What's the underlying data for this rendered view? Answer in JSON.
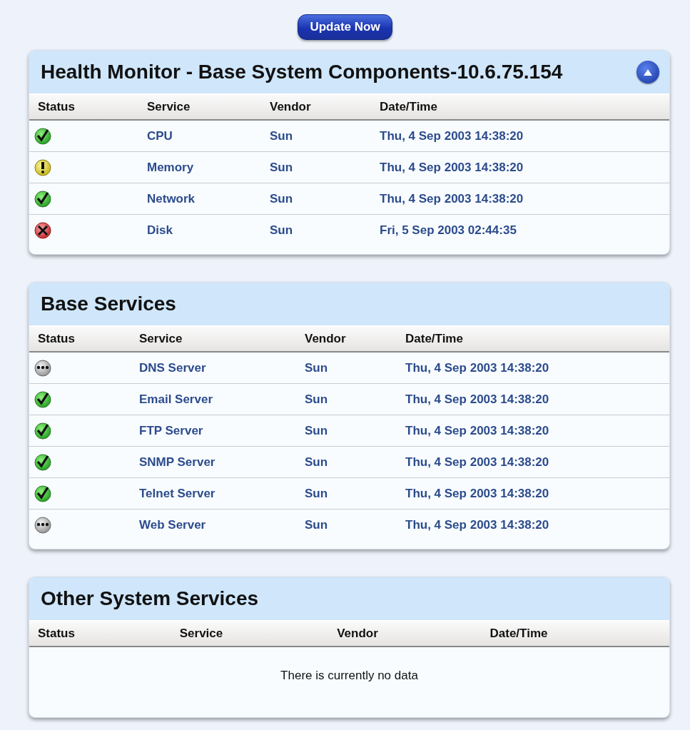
{
  "update_button": "Update Now",
  "panels": [
    {
      "title": "Health Monitor - Base System Components-10.6.75.154",
      "collapse_button": true,
      "columns": [
        "Status",
        "Service",
        "Vendor",
        "Date/Time"
      ],
      "rows": [
        {
          "kind": "ok",
          "service": "CPU",
          "vendor": "Sun",
          "datetime": "Thu, 4 Sep 2003 14:38:20"
        },
        {
          "kind": "warning",
          "service": "Memory",
          "vendor": "Sun",
          "datetime": "Thu, 4 Sep 2003 14:38:20"
        },
        {
          "kind": "ok",
          "service": "Network",
          "vendor": "Sun",
          "datetime": "Thu, 4 Sep 2003 14:38:20"
        },
        {
          "kind": "error",
          "service": "Disk",
          "vendor": "Sun",
          "datetime": "Fri, 5 Sep 2003 02:44:35"
        }
      ]
    },
    {
      "title": "Base Services",
      "collapse_button": false,
      "columns": [
        "Status",
        "Service",
        "Vendor",
        "Date/Time"
      ],
      "rows": [
        {
          "kind": "unknown",
          "service": "DNS Server",
          "vendor": "Sun",
          "datetime": "Thu, 4 Sep 2003 14:38:20"
        },
        {
          "kind": "ok",
          "service": "Email Server",
          "vendor": "Sun",
          "datetime": "Thu, 4 Sep 2003 14:38:20"
        },
        {
          "kind": "ok",
          "service": "FTP Server",
          "vendor": "Sun",
          "datetime": "Thu, 4 Sep 2003 14:38:20"
        },
        {
          "kind": "ok",
          "service": "SNMP Server",
          "vendor": "Sun",
          "datetime": "Thu, 4 Sep 2003 14:38:20"
        },
        {
          "kind": "ok",
          "service": "Telnet Server",
          "vendor": "Sun",
          "datetime": "Thu, 4 Sep 2003 14:38:20"
        },
        {
          "kind": "unknown",
          "service": "Web Server",
          "vendor": "Sun",
          "datetime": "Thu, 4 Sep 2003 14:38:20"
        }
      ]
    },
    {
      "title": "Other System Services",
      "collapse_button": false,
      "columns": [
        "Status",
        "Service",
        "Vendor",
        "Date/Time"
      ],
      "empty_message": "There is currently no data"
    }
  ]
}
